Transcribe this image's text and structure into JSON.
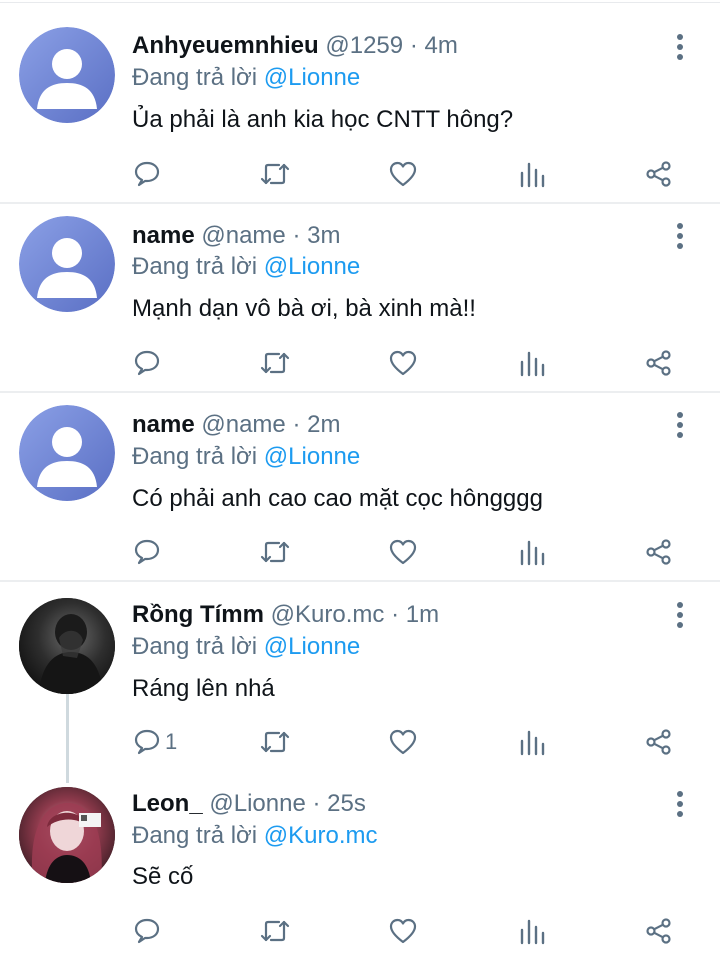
{
  "icons": {
    "reply": "reply-icon",
    "retweet": "retweet-icon",
    "like": "heart-icon",
    "analytics": "analytics-icon",
    "share": "share-icon",
    "more": "more-vertical-icon"
  },
  "colors": {
    "mention": "#1d9bf0",
    "secondary_text": "#5b7083",
    "default_avatar": "#6b7fcf"
  },
  "tweets": [
    {
      "display_name": "Anhyeuemnhieu",
      "handle": "@1259",
      "time": "· 4m",
      "replying_prefix": "Đang trả lời",
      "replying_to": "@Lionne",
      "text": "Ủa phải là anh kia học CNTT hông?",
      "reply_count": ""
    },
    {
      "display_name": "name",
      "handle": "@name",
      "time": "· 3m",
      "replying_prefix": "Đang trả lời",
      "replying_to": "@Lionne",
      "text": "Mạnh dạn vô bà ơi, bà xinh mà!!",
      "reply_count": ""
    },
    {
      "display_name": "name",
      "handle": "@name",
      "time": "· 2m",
      "replying_prefix": "Đang trả lời",
      "replying_to": "@Lionne",
      "text": "Có phải anh cao cao mặt cọc hôngggg",
      "reply_count": ""
    },
    {
      "display_name": "Rồng Tímm",
      "handle": "@Kuro.mc",
      "time": "· 1m",
      "replying_prefix": "Đang trả lời",
      "replying_to": "@Lionne",
      "text": "Ráng lên nhá",
      "reply_count": "1"
    },
    {
      "display_name": "Leon_",
      "handle": "@Lionne",
      "time": "· 25s",
      "replying_prefix": "Đang trả lời",
      "replying_to": "@Kuro.mc",
      "text": "Sẽ cố",
      "reply_count": ""
    }
  ]
}
